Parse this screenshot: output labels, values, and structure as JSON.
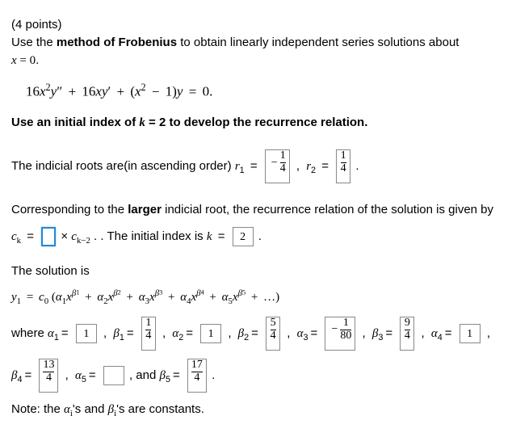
{
  "header": {
    "points": "(4 points)",
    "line1a": "Use the ",
    "method": "method of Frobenius",
    "line1b": " to obtain linearly independent series solutions about",
    "line2_pre": "x",
    "line2_eq": " = 0",
    "line2_dot": "."
  },
  "ode": "16x²y″ + 16xy′ + (x² − 1)y = 0.",
  "instruction": {
    "a": "Use an initial index of ",
    "k": "k",
    "eq2": " = 2",
    "b": " to develop the recurrence relation."
  },
  "indicial": {
    "text": "The indicial roots are(in ascending order) ",
    "r1_label": "r",
    "r1_sub": "1",
    "r1_val_n": "1",
    "r1_val_d": "4",
    "r2_label": "r",
    "r2_sub": "2",
    "r2_val_n": "1",
    "r2_val_d": "4",
    "dot": "."
  },
  "recur": {
    "line1a": "Corresponding to the ",
    "larger": "larger",
    "line1b": " indicial root, the recurrence relation of the solution is given by",
    "ck": "c",
    "k": "k",
    "times": "×",
    "ckm2": "c",
    "km2": "k−2",
    "after": ". The initial index is ",
    "kval": "2",
    "dot": "."
  },
  "solution": {
    "title": "The solution is",
    "y1eq": "y₁ = c₀ (α₁xᵝ¹ + α₂xᵝ² + α₃xᵝ³ + α₄xᵝ⁴ + α₅xᵝ⁵ + …)"
  },
  "coeffs": {
    "where": "where ",
    "a1": "1",
    "b1_n": "1",
    "b1_d": "4",
    "a2": "1",
    "b2_n": "5",
    "b2_d": "4",
    "a3_n": "1",
    "a3_d": "80",
    "b3_n": "9",
    "b3_d": "4",
    "a4": "1",
    "b4_n": "13",
    "b4_d": "4",
    "a5": "",
    "and": ", and ",
    "b5_n": "17",
    "b5_d": "4",
    "dot": "."
  },
  "note": {
    "pre": "Note: the ",
    "mid": "'s and ",
    "post": "'s are constants."
  },
  "labels": {
    "alpha": "α",
    "beta": "β",
    "eq": "=",
    "minus": "−",
    "comma": ","
  }
}
